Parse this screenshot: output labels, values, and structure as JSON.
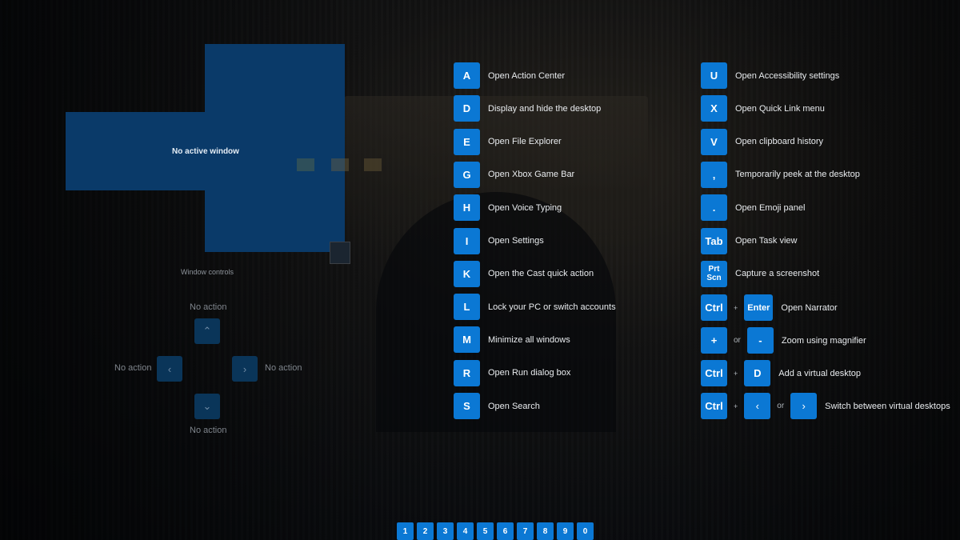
{
  "colors": {
    "accent": "#0b78d4",
    "snap_zone": "#0a3a69",
    "dpad": "#0a3559"
  },
  "snap_preview": {
    "label": "No active window"
  },
  "window_controls": {
    "title": "Window controls",
    "up": {
      "label": "No action",
      "icon": "chevron-up"
    },
    "left": {
      "label": "No action",
      "icon": "chevron-left"
    },
    "right": {
      "label": "No action",
      "icon": "chevron-right"
    },
    "down": {
      "label": "No action",
      "icon": "chevron-down"
    }
  },
  "shortcuts_left": [
    {
      "key": "A",
      "desc": "Open Action Center"
    },
    {
      "key": "D",
      "desc": "Display and hide the desktop"
    },
    {
      "key": "E",
      "desc": "Open File Explorer"
    },
    {
      "key": "G",
      "desc": "Open Xbox Game Bar"
    },
    {
      "key": "H",
      "desc": "Open Voice Typing"
    },
    {
      "key": "I",
      "desc": "Open Settings"
    },
    {
      "key": "K",
      "desc": "Open the Cast quick action"
    },
    {
      "key": "L",
      "desc": "Lock your PC or switch accounts"
    },
    {
      "key": "M",
      "desc": "Minimize all windows"
    },
    {
      "key": "R",
      "desc": "Open Run dialog box"
    },
    {
      "key": "S",
      "desc": "Open Search"
    }
  ],
  "shortcuts_right": [
    {
      "key": "U",
      "desc": "Open Accessibility settings"
    },
    {
      "key": "X",
      "desc": "Open Quick Link menu"
    },
    {
      "key": "V",
      "desc": "Open clipboard history"
    },
    {
      "key": ",",
      "desc": "Temporarily peek at the desktop"
    },
    {
      "key": ".",
      "desc": "Open Emoji panel"
    },
    {
      "key": "Tab",
      "desc": "Open Task view"
    },
    {
      "key_line1": "Prt",
      "key_line2": "Scn",
      "desc": "Capture a screenshot"
    }
  ],
  "combos": {
    "narrator": {
      "key1": "Ctrl",
      "sep": "+",
      "key2": "Enter",
      "desc": "Open Narrator"
    },
    "magnifier": {
      "key1": "+",
      "sep": "or",
      "key2": "-",
      "desc": "Zoom using magnifier"
    },
    "add_desktop": {
      "key1": "Ctrl",
      "sep": "+",
      "key2": "D",
      "desc": "Add a virtual desktop"
    },
    "switch_desktop": {
      "key1": "Ctrl",
      "sep1": "+",
      "key2": "<",
      "sep2": "or",
      "key3": ">",
      "desc": "Switch between virtual desktops"
    }
  },
  "desktops": [
    "1",
    "2",
    "3",
    "4",
    "5",
    "6",
    "7",
    "8",
    "9",
    "0"
  ]
}
